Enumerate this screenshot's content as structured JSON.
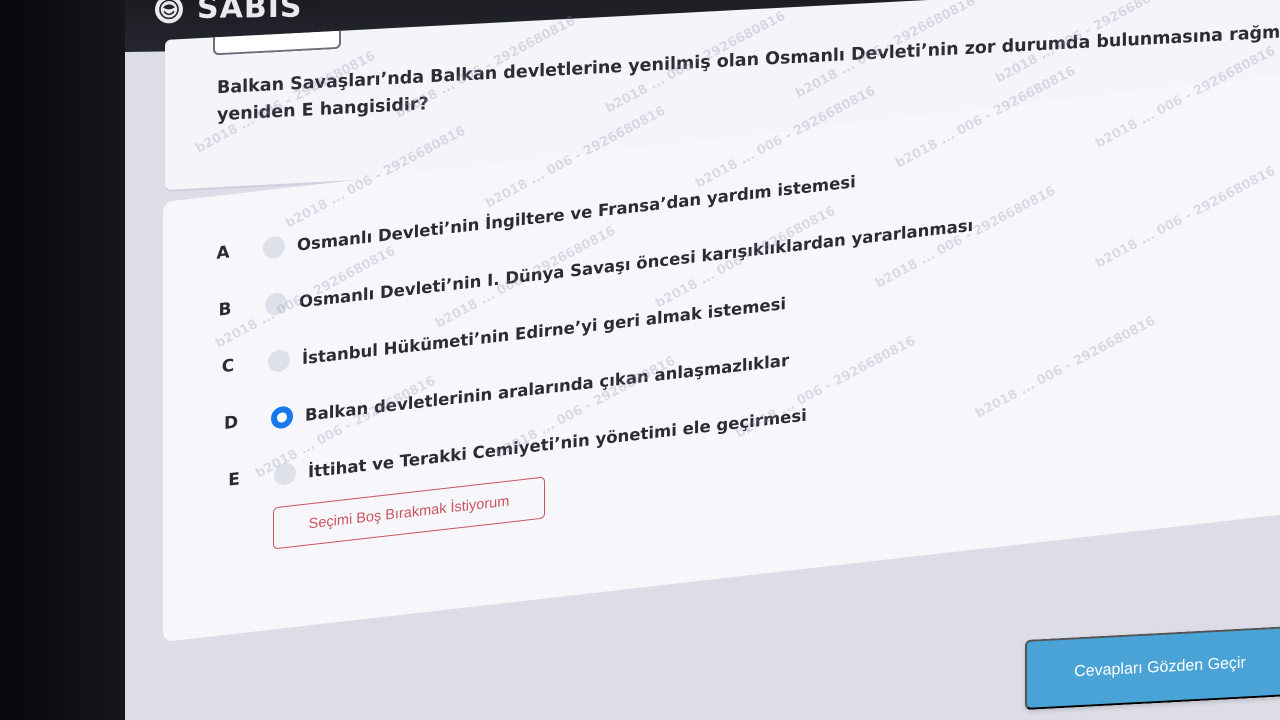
{
  "app": {
    "name": "SABIS"
  },
  "question": {
    "text": "Balkan Savaşları’nda Balkan devletlerine yenilmiş olan Osmanlı Devleti’nin zor durumda bulunmasına rağmen yeniden E hangisidir?"
  },
  "options": [
    {
      "letter": "A",
      "text": "Osmanlı Devleti’nin İngiltere ve Fransa’dan yardım istemesi",
      "selected": false
    },
    {
      "letter": "B",
      "text": "Osmanlı Devleti’nin I. Dünya Savaşı öncesi karışıklıklardan yararlanması",
      "selected": false
    },
    {
      "letter": "C",
      "text": "İstanbul Hükümeti’nin Edirne’yi geri almak istemesi",
      "selected": false
    },
    {
      "letter": "D",
      "text": "Balkan devletlerinin aralarında çıkan anlaşmazlıklar",
      "selected": true
    },
    {
      "letter": "E",
      "text": "İttihat ve Terakki Cemiyeti’nin yönetimi ele geçirmesi",
      "selected": false
    }
  ],
  "buttons": {
    "skip_label": "Seçimi Boş Bırakmak İstiyorum",
    "review_label": "Cevapları Gözden Geçir"
  },
  "watermark": {
    "text": "b2018 ... 006 - 2926680816"
  },
  "colors": {
    "selected_radio": "#1878ee",
    "skip_border": "#c9545f",
    "review_button": "#4aa3d6"
  }
}
